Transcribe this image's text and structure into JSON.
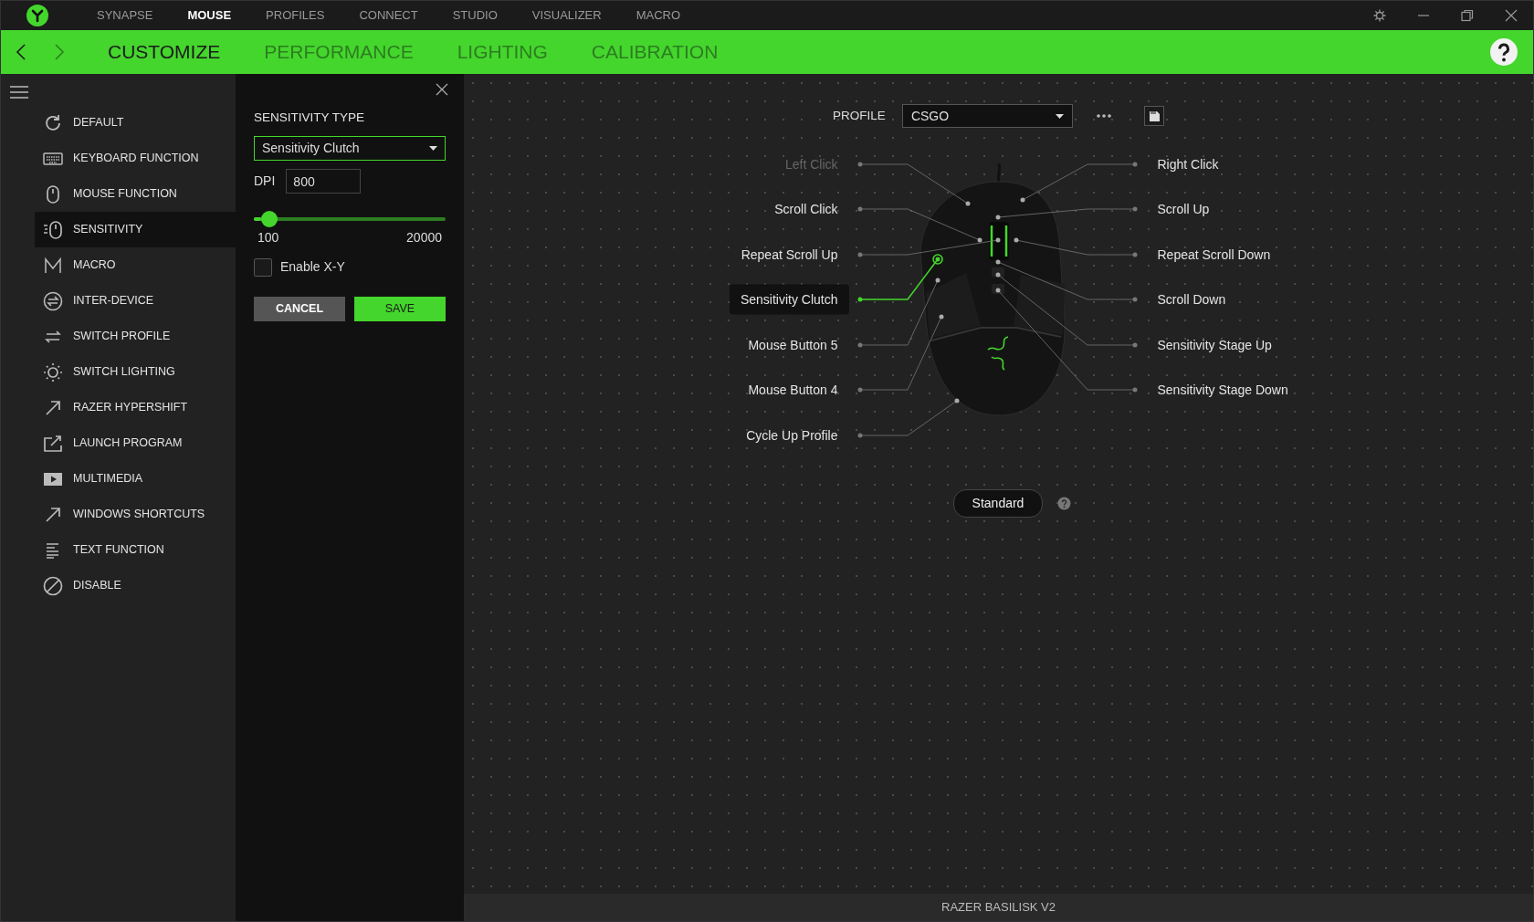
{
  "top_tabs": [
    {
      "label": "SYNAPSE",
      "selected": false
    },
    {
      "label": "MOUSE",
      "selected": true
    },
    {
      "label": "PROFILES",
      "selected": false
    },
    {
      "label": "CONNECT",
      "selected": false
    },
    {
      "label": "STUDIO",
      "selected": false
    },
    {
      "label": "VISUALIZER",
      "selected": false
    },
    {
      "label": "MACRO",
      "selected": false
    }
  ],
  "sub_tabs": [
    {
      "label": "CUSTOMIZE",
      "selected": true
    },
    {
      "label": "PERFORMANCE",
      "selected": false
    },
    {
      "label": "LIGHTING",
      "selected": false
    },
    {
      "label": "CALIBRATION",
      "selected": false
    }
  ],
  "sidebar": {
    "items": [
      {
        "label": "DEFAULT",
        "selected": false
      },
      {
        "label": "KEYBOARD FUNCTION",
        "selected": false
      },
      {
        "label": "MOUSE FUNCTION",
        "selected": false
      },
      {
        "label": "SENSITIVITY",
        "selected": true
      },
      {
        "label": "MACRO",
        "selected": false
      },
      {
        "label": "INTER-DEVICE",
        "selected": false
      },
      {
        "label": "SWITCH PROFILE",
        "selected": false
      },
      {
        "label": "SWITCH LIGHTING",
        "selected": false
      },
      {
        "label": "RAZER HYPERSHIFT",
        "selected": false
      },
      {
        "label": "LAUNCH PROGRAM",
        "selected": false
      },
      {
        "label": "MULTIMEDIA",
        "selected": false
      },
      {
        "label": "WINDOWS SHORTCUTS",
        "selected": false
      },
      {
        "label": "TEXT FUNCTION",
        "selected": false
      },
      {
        "label": "DISABLE",
        "selected": false
      }
    ]
  },
  "panel": {
    "title": "SENSITIVITY TYPE",
    "type_value": "Sensitivity Clutch",
    "dpi_label": "DPI",
    "dpi_value": "800",
    "slider": {
      "level": 0.04,
      "min_label": "100",
      "max_label": "20000"
    },
    "enable_xy": {
      "label": "Enable X-Y",
      "checked": false
    },
    "cancel": "CANCEL",
    "save": "SAVE"
  },
  "profile": {
    "label": "PROFILE",
    "value": "CSGO"
  },
  "left_buttons": [
    {
      "label": "Left Click",
      "selected": false,
      "disabled": true
    },
    {
      "label": "Scroll Click",
      "selected": false,
      "disabled": false
    },
    {
      "label": "Repeat Scroll Up",
      "selected": false,
      "disabled": false
    },
    {
      "label": "Sensitivity Clutch",
      "selected": true,
      "disabled": false
    },
    {
      "label": "Mouse Button 5",
      "selected": false,
      "disabled": false
    },
    {
      "label": "Mouse Button 4",
      "selected": false,
      "disabled": false
    },
    {
      "label": "Cycle Up Profile",
      "selected": false,
      "disabled": false
    }
  ],
  "right_buttons": [
    {
      "label": "Right Click",
      "selected": false,
      "disabled": false
    },
    {
      "label": "Scroll Up",
      "selected": false,
      "disabled": false
    },
    {
      "label": "Repeat Scroll Down",
      "selected": false,
      "disabled": false
    },
    {
      "label": "Scroll Down",
      "selected": false,
      "disabled": false
    },
    {
      "label": "Sensitivity Stage Up",
      "selected": false,
      "disabled": false
    },
    {
      "label": "Sensitivity Stage Down",
      "selected": false,
      "disabled": false
    }
  ],
  "mode": "Standard",
  "status_bar": "RAZER BASILISK V2"
}
